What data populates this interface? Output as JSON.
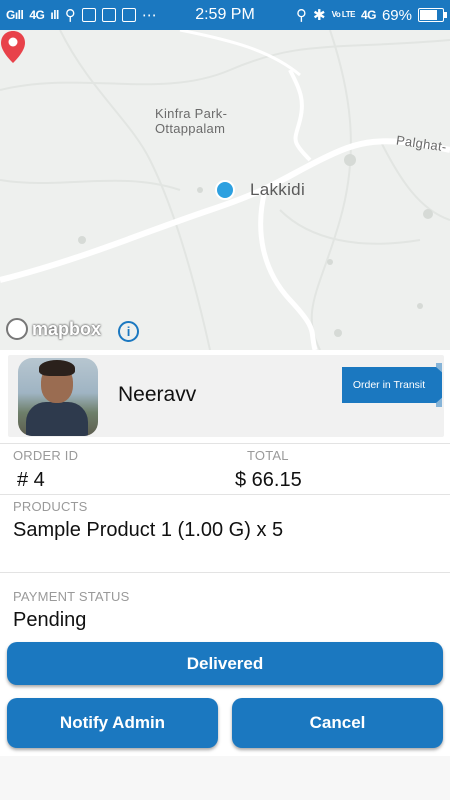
{
  "status_bar": {
    "signal_left": "G",
    "network": "4G",
    "time": "2:59 PM",
    "volte": "Vo LTE",
    "network_right": "4G",
    "battery": "69%"
  },
  "map": {
    "labels": {
      "park_line1": "Kinfra Park-",
      "park_line2": "Ottappalam",
      "town": "Lakkidi",
      "road": "Palghat-"
    },
    "attribution": "mapbox",
    "info_glyph": "i",
    "colors": {
      "land": "#eef0ee",
      "road": "#ffffff",
      "pin": "#e8424a",
      "location_dot": "#2da0e0"
    }
  },
  "driver": {
    "name": "Neeravv",
    "status_tag": "Order in Transit"
  },
  "order": {
    "order_id_label": "ORDER ID",
    "order_id_value": "# 4",
    "total_label": "TOTAL",
    "total_value": "$ 66.15",
    "products_label": "PRODUCTS",
    "products_value": "Sample Product  1 (1.00 G) x 5",
    "payment_label": "PAYMENT STATUS",
    "payment_value": "Pending"
  },
  "actions": {
    "delivered": "Delivered",
    "notify_admin": "Notify Admin",
    "cancel": "Cancel"
  },
  "theme": {
    "accent": "#1b78c0"
  }
}
